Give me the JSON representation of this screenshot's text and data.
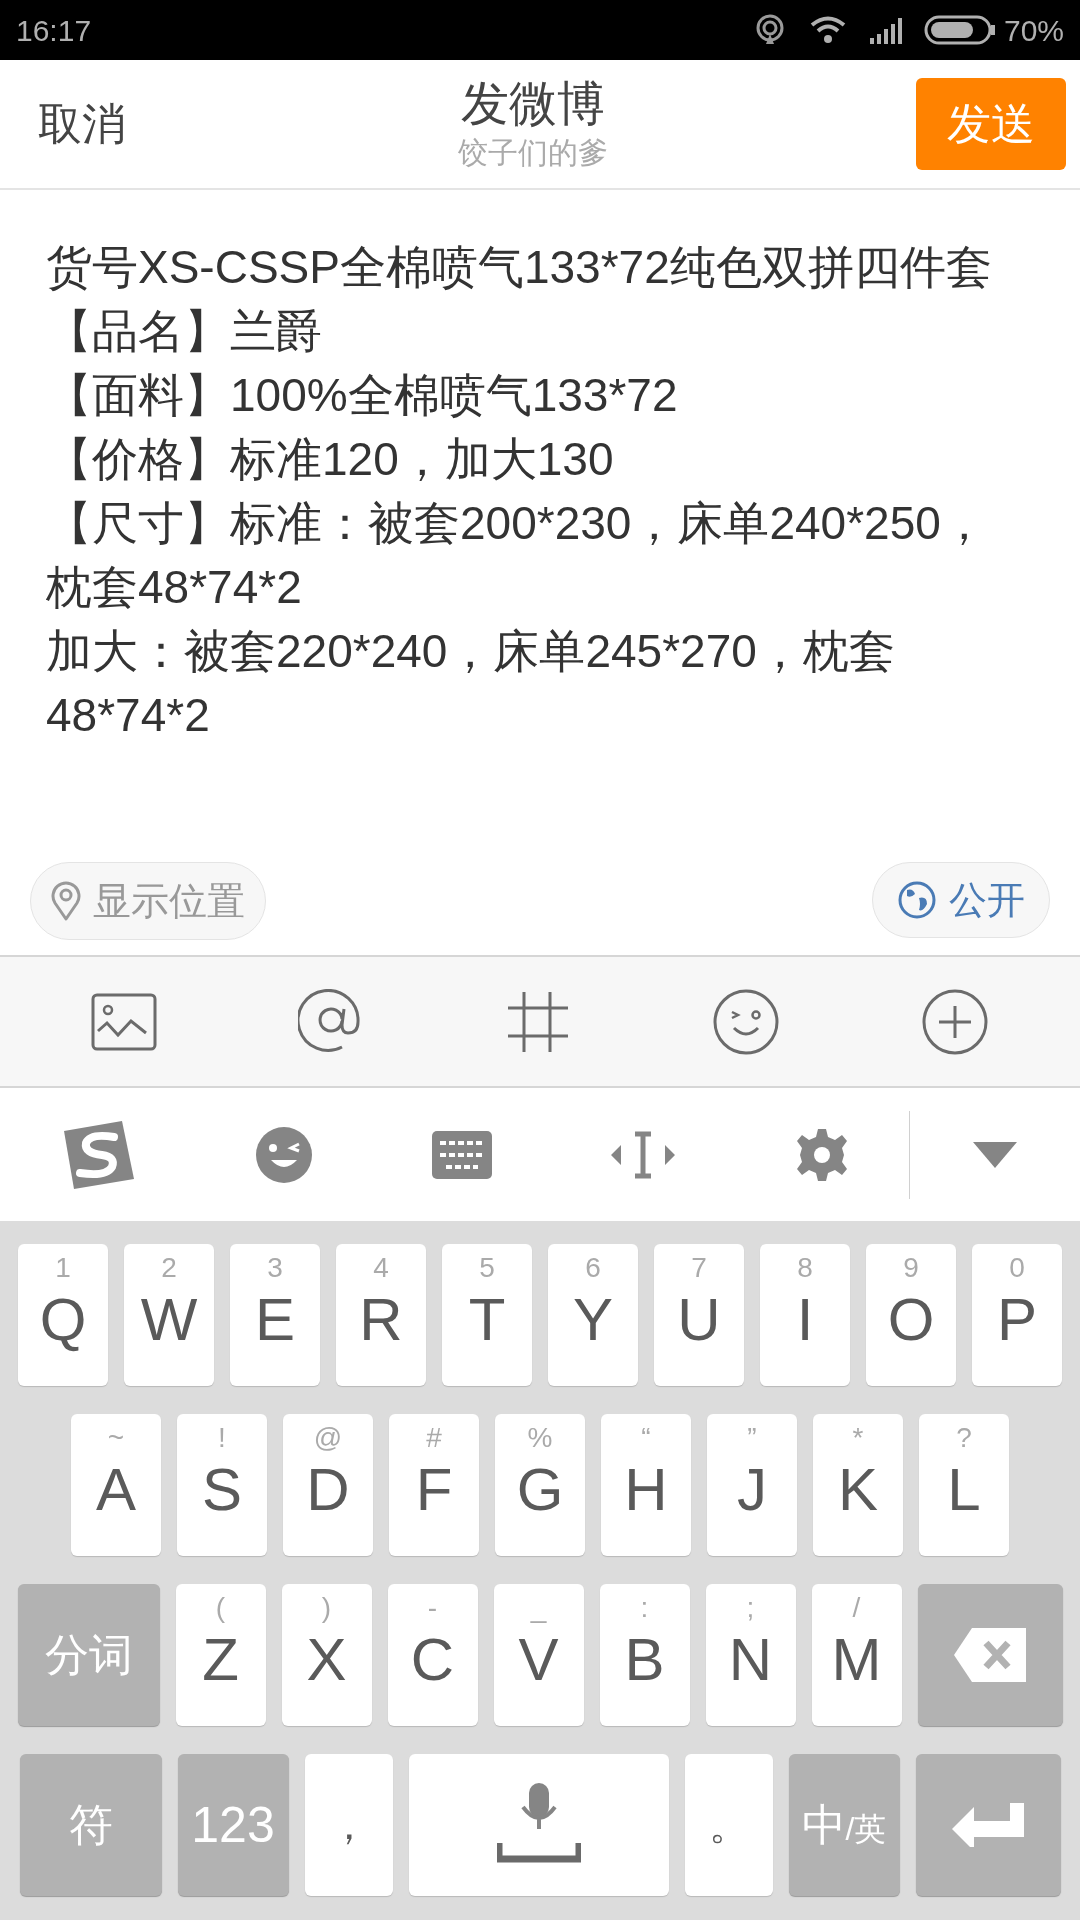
{
  "status_bar": {
    "time": "16:17",
    "battery": "70%"
  },
  "header": {
    "cancel": "取消",
    "title": "发微博",
    "subtitle": "饺子们的爹",
    "send": "发送"
  },
  "compose": {
    "paragraphs": [
      "货号XS-CSSP全棉喷气133*72纯色双拼四件套",
      "【品名】兰爵",
      "【面料】100%全棉喷气133*72",
      "【价格】标准120，加大130",
      "【尺寸】标准：被套200*230，床单240*250，枕套48*74*2",
      "加大：被套220*240，床单245*270，枕套48*74*2"
    ]
  },
  "location": {
    "label": "显示位置"
  },
  "visibility": {
    "label": "公开"
  },
  "keyboard_rows": [
    [
      {
        "kind": "letter",
        "main": "Q",
        "sub": "1"
      },
      {
        "kind": "letter",
        "main": "W",
        "sub": "2"
      },
      {
        "kind": "letter",
        "main": "E",
        "sub": "3"
      },
      {
        "kind": "letter",
        "main": "R",
        "sub": "4"
      },
      {
        "kind": "letter",
        "main": "T",
        "sub": "5"
      },
      {
        "kind": "letter",
        "main": "Y",
        "sub": "6"
      },
      {
        "kind": "letter",
        "main": "U",
        "sub": "7"
      },
      {
        "kind": "letter",
        "main": "I",
        "sub": "8"
      },
      {
        "kind": "letter",
        "main": "O",
        "sub": "9"
      },
      {
        "kind": "letter",
        "main": "P",
        "sub": "0"
      }
    ],
    [
      {
        "kind": "letter",
        "main": "A",
        "sub": "~"
      },
      {
        "kind": "letter",
        "main": "S",
        "sub": "!"
      },
      {
        "kind": "letter",
        "main": "D",
        "sub": "@"
      },
      {
        "kind": "letter",
        "main": "F",
        "sub": "#"
      },
      {
        "kind": "letter",
        "main": "G",
        "sub": "%"
      },
      {
        "kind": "letter",
        "main": "H",
        "sub": "“"
      },
      {
        "kind": "letter",
        "main": "J",
        "sub": "”"
      },
      {
        "kind": "letter",
        "main": "K",
        "sub": "*"
      },
      {
        "kind": "letter",
        "main": "L",
        "sub": "?"
      }
    ],
    [
      {
        "kind": "function",
        "main": "分词"
      },
      {
        "kind": "letter",
        "main": "Z",
        "sub": "("
      },
      {
        "kind": "letter",
        "main": "X",
        "sub": ")"
      },
      {
        "kind": "letter",
        "main": "C",
        "sub": "-"
      },
      {
        "kind": "letter",
        "main": "V",
        "sub": "_"
      },
      {
        "kind": "letter",
        "main": "B",
        "sub": ":"
      },
      {
        "kind": "letter",
        "main": "N",
        "sub": ";"
      },
      {
        "kind": "letter",
        "main": "M",
        "sub": "/"
      },
      {
        "kind": "backspace"
      }
    ],
    [
      {
        "kind": "function",
        "main": "符"
      },
      {
        "kind": "function-narrow",
        "main": "123"
      },
      {
        "kind": "punct",
        "main": "，"
      },
      {
        "kind": "space"
      },
      {
        "kind": "punct",
        "main": "。"
      },
      {
        "kind": "language",
        "main": "中",
        "sub": "/英"
      },
      {
        "kind": "enter"
      }
    ]
  ]
}
